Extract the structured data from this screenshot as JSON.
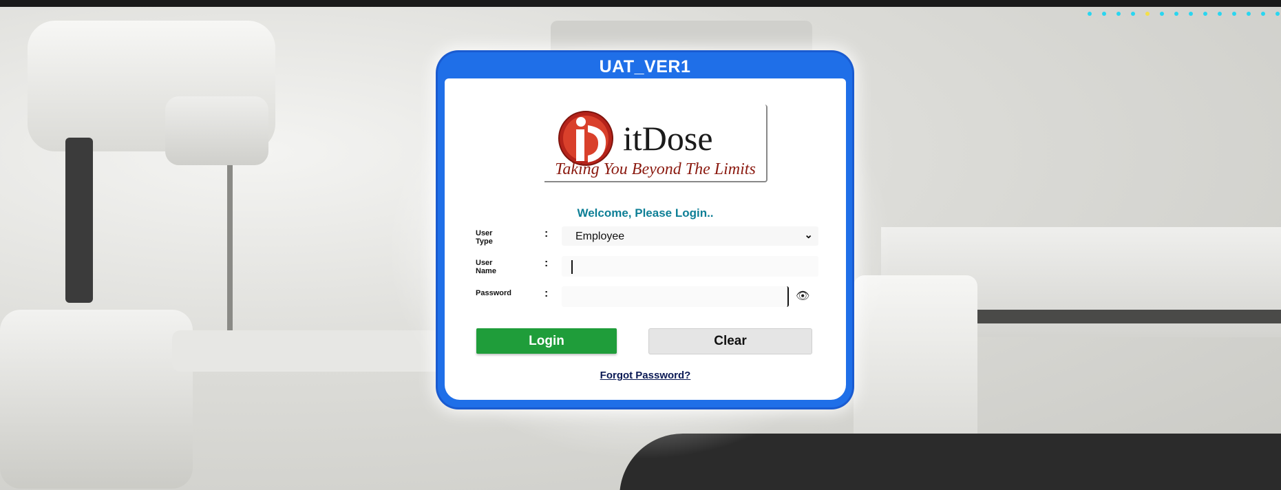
{
  "window": {
    "title": "UAT_VER1"
  },
  "brand": {
    "name": "itDose",
    "tagline": "Taking You Beyond The Limits",
    "logo_icon": "itdose-logo-icon",
    "accent": "#8b1a10"
  },
  "login": {
    "welcome": "Welcome, Please Login..",
    "user_type_label": "User Type",
    "user_type_value": "Employee",
    "user_name_label": "User Name",
    "user_name_value": "",
    "password_label": "Password",
    "password_value": "",
    "separator": ":",
    "login_button": "Login",
    "clear_button": "Clear",
    "forgot_link": "Forgot Password?",
    "colors": {
      "login": "#1f9d3a",
      "frame": "#1f6fe8",
      "welcome": "#0e7f96"
    }
  },
  "icons": {
    "user_type_dropdown": "chevron-down-icon",
    "password_toggle": "eye-icon",
    "password_toggle_glyph": "👁"
  }
}
